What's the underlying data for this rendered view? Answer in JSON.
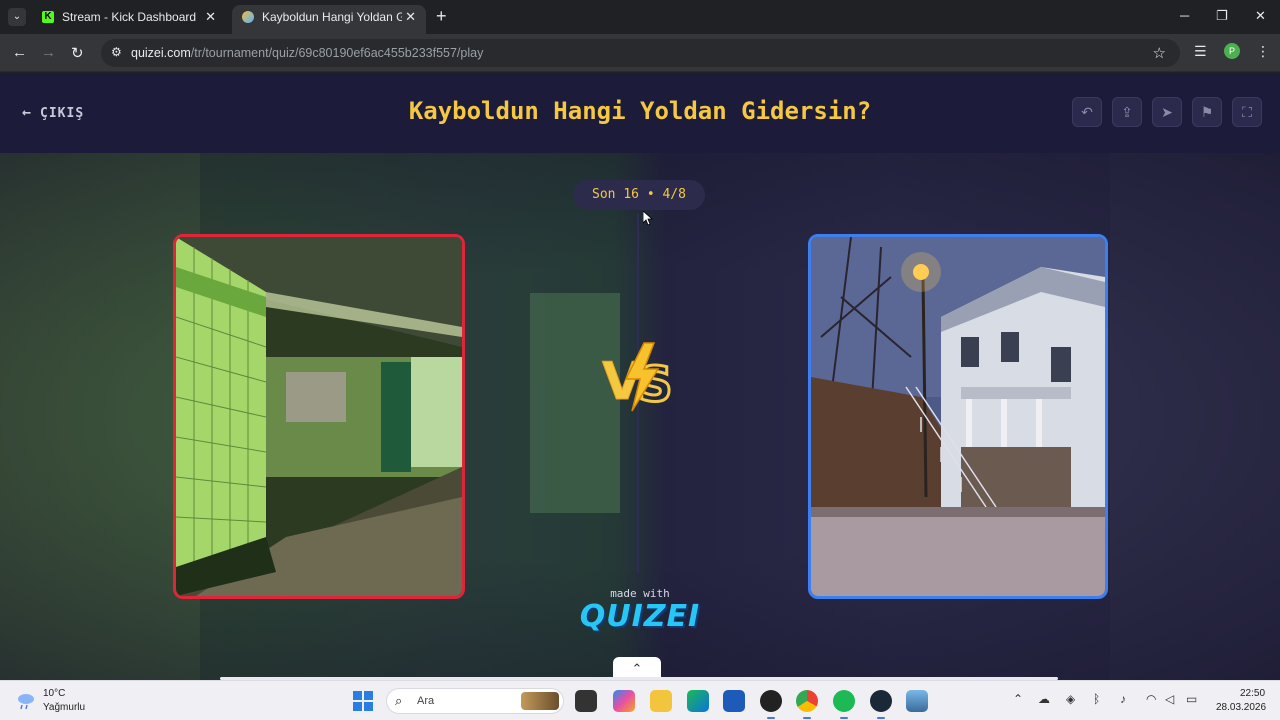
{
  "browser": {
    "tabs": [
      {
        "title": "Stream - Kick Dashboard",
        "active": false
      },
      {
        "title": "Kayboldun Hangi Yoldan Gidersin?",
        "active": true
      }
    ],
    "url_host": "quizei.com",
    "url_path": "/tr/tournament/quiz/69c80190ef6ac455b233f557/play",
    "profile_initial": "P"
  },
  "page": {
    "exit_label": "ÇIKIŞ",
    "title": "Kayboldun Hangi Yoldan Gidersin?",
    "round_label": "Son 16 • 4/8",
    "made_with": "made with",
    "brand": "QUIZEI",
    "colors": {
      "title": "#f5c842",
      "left_border": "#e0243a",
      "right_border": "#3d7ff0",
      "brand": "#27c6f5"
    }
  },
  "taskbar": {
    "weather_temp": "10°C",
    "weather_condition": "Yağmurlu",
    "search_placeholder": "Ara",
    "time": "22:50",
    "date": "28.03.2026"
  }
}
